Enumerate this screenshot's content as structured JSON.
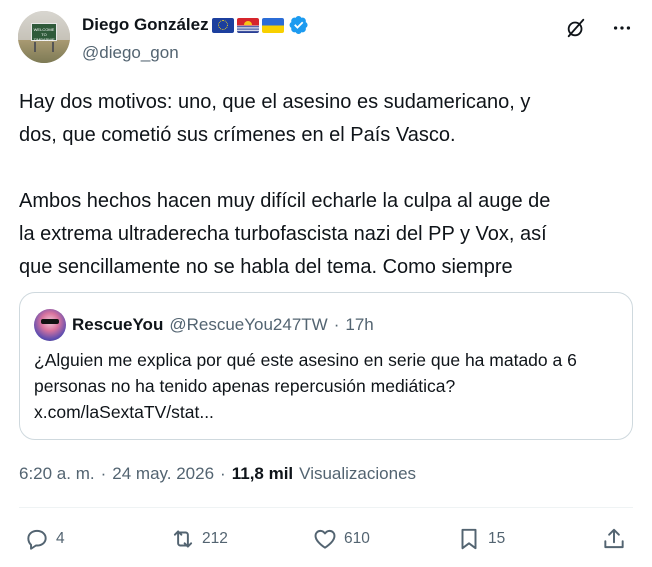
{
  "author": {
    "name": "Diego González",
    "handle": "@diego_gon",
    "avatar_sign_text": "WELCOME TO ZIMBABWE",
    "flags": [
      "eu-flag",
      "kiribati-flag",
      "ukraine-flag"
    ],
    "verified_icon": "verified-badge-icon",
    "verified_color": "#1d9bf0"
  },
  "top_actions": {
    "grok_icon": "grok-icon",
    "more_icon": "more-options-icon"
  },
  "post": {
    "text": "Hay dos motivos: uno, que el asesino es sudamericano, y\ndos, que cometió sus crímenes en el País Vasco.\n\nAmbos hechos hacen muy difícil echarle la culpa al auge de\nla extrema ultraderecha turbofascista nazi del PP y Vox, así\nque sencillamente no se habla del tema. Como siempre"
  },
  "quote": {
    "name": "RescueYou",
    "handle": "@RescueYou247TW",
    "separator": "·",
    "time": "17h",
    "text": "¿Alguien me explica por qué este asesino en serie que ha matado a 6 personas no ha tenido apenas repercusión mediática? x.com/laSextaTV/stat..."
  },
  "meta": {
    "time": "6:20 a. m.",
    "separator1": "·",
    "date": "24 may. 2026",
    "separator2": "·",
    "views_count": "11,8 mil",
    "views_label": "Visualizaciones"
  },
  "actions": {
    "replies": "4",
    "reposts": "212",
    "likes": "610",
    "bookmarks": "15",
    "icon_color": "#536471"
  }
}
